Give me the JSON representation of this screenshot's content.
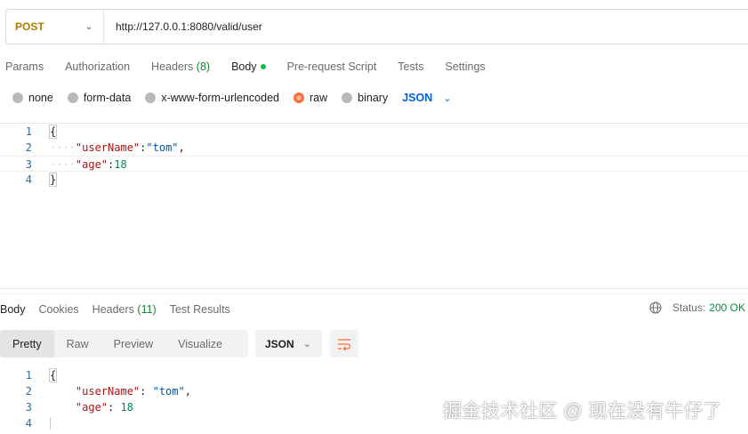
{
  "request": {
    "method": "POST",
    "url": "http://127.0.0.1:8080/valid/user"
  },
  "request_tabs": {
    "params": "Params",
    "authorization": "Authorization",
    "headers": "Headers",
    "headers_count": "(8)",
    "body": "Body",
    "pre_request": "Pre-request Script",
    "tests": "Tests",
    "settings": "Settings"
  },
  "body_types": {
    "none": "none",
    "form_data": "form-data",
    "urlencoded": "x-www-form-urlencoded",
    "raw": "raw",
    "binary": "binary",
    "selected": "raw",
    "format": "JSON"
  },
  "request_body": {
    "line_numbers": [
      "1",
      "2",
      "3",
      "4"
    ],
    "open_brace": "{",
    "key1": "\"userName\"",
    "val1": "\"tom\"",
    "key2": "\"age\"",
    "val2": "18",
    "close_brace": "}"
  },
  "response_tabs": {
    "body": "Body",
    "cookies": "Cookies",
    "headers": "Headers",
    "headers_count": "(11)",
    "test_results": "Test Results"
  },
  "response_status": {
    "label": "Status:",
    "value": "200 OK"
  },
  "response_view": {
    "pretty": "Pretty",
    "raw": "Raw",
    "preview": "Preview",
    "visualize": "Visualize",
    "format": "JSON"
  },
  "response_body": {
    "line_numbers": [
      "1",
      "2",
      "3",
      "4"
    ],
    "open_brace": "{",
    "key1": "\"userName\"",
    "val1": "\"tom\"",
    "key2": "\"age\"",
    "val2": "18"
  },
  "watermark": "掘金技术社区 @ 现在没有牛仔了",
  "colors": {
    "method": "#ad7a03",
    "accent": "#ff6c37",
    "link_blue": "#0265d2",
    "status_ok": "#0c8a3e"
  }
}
